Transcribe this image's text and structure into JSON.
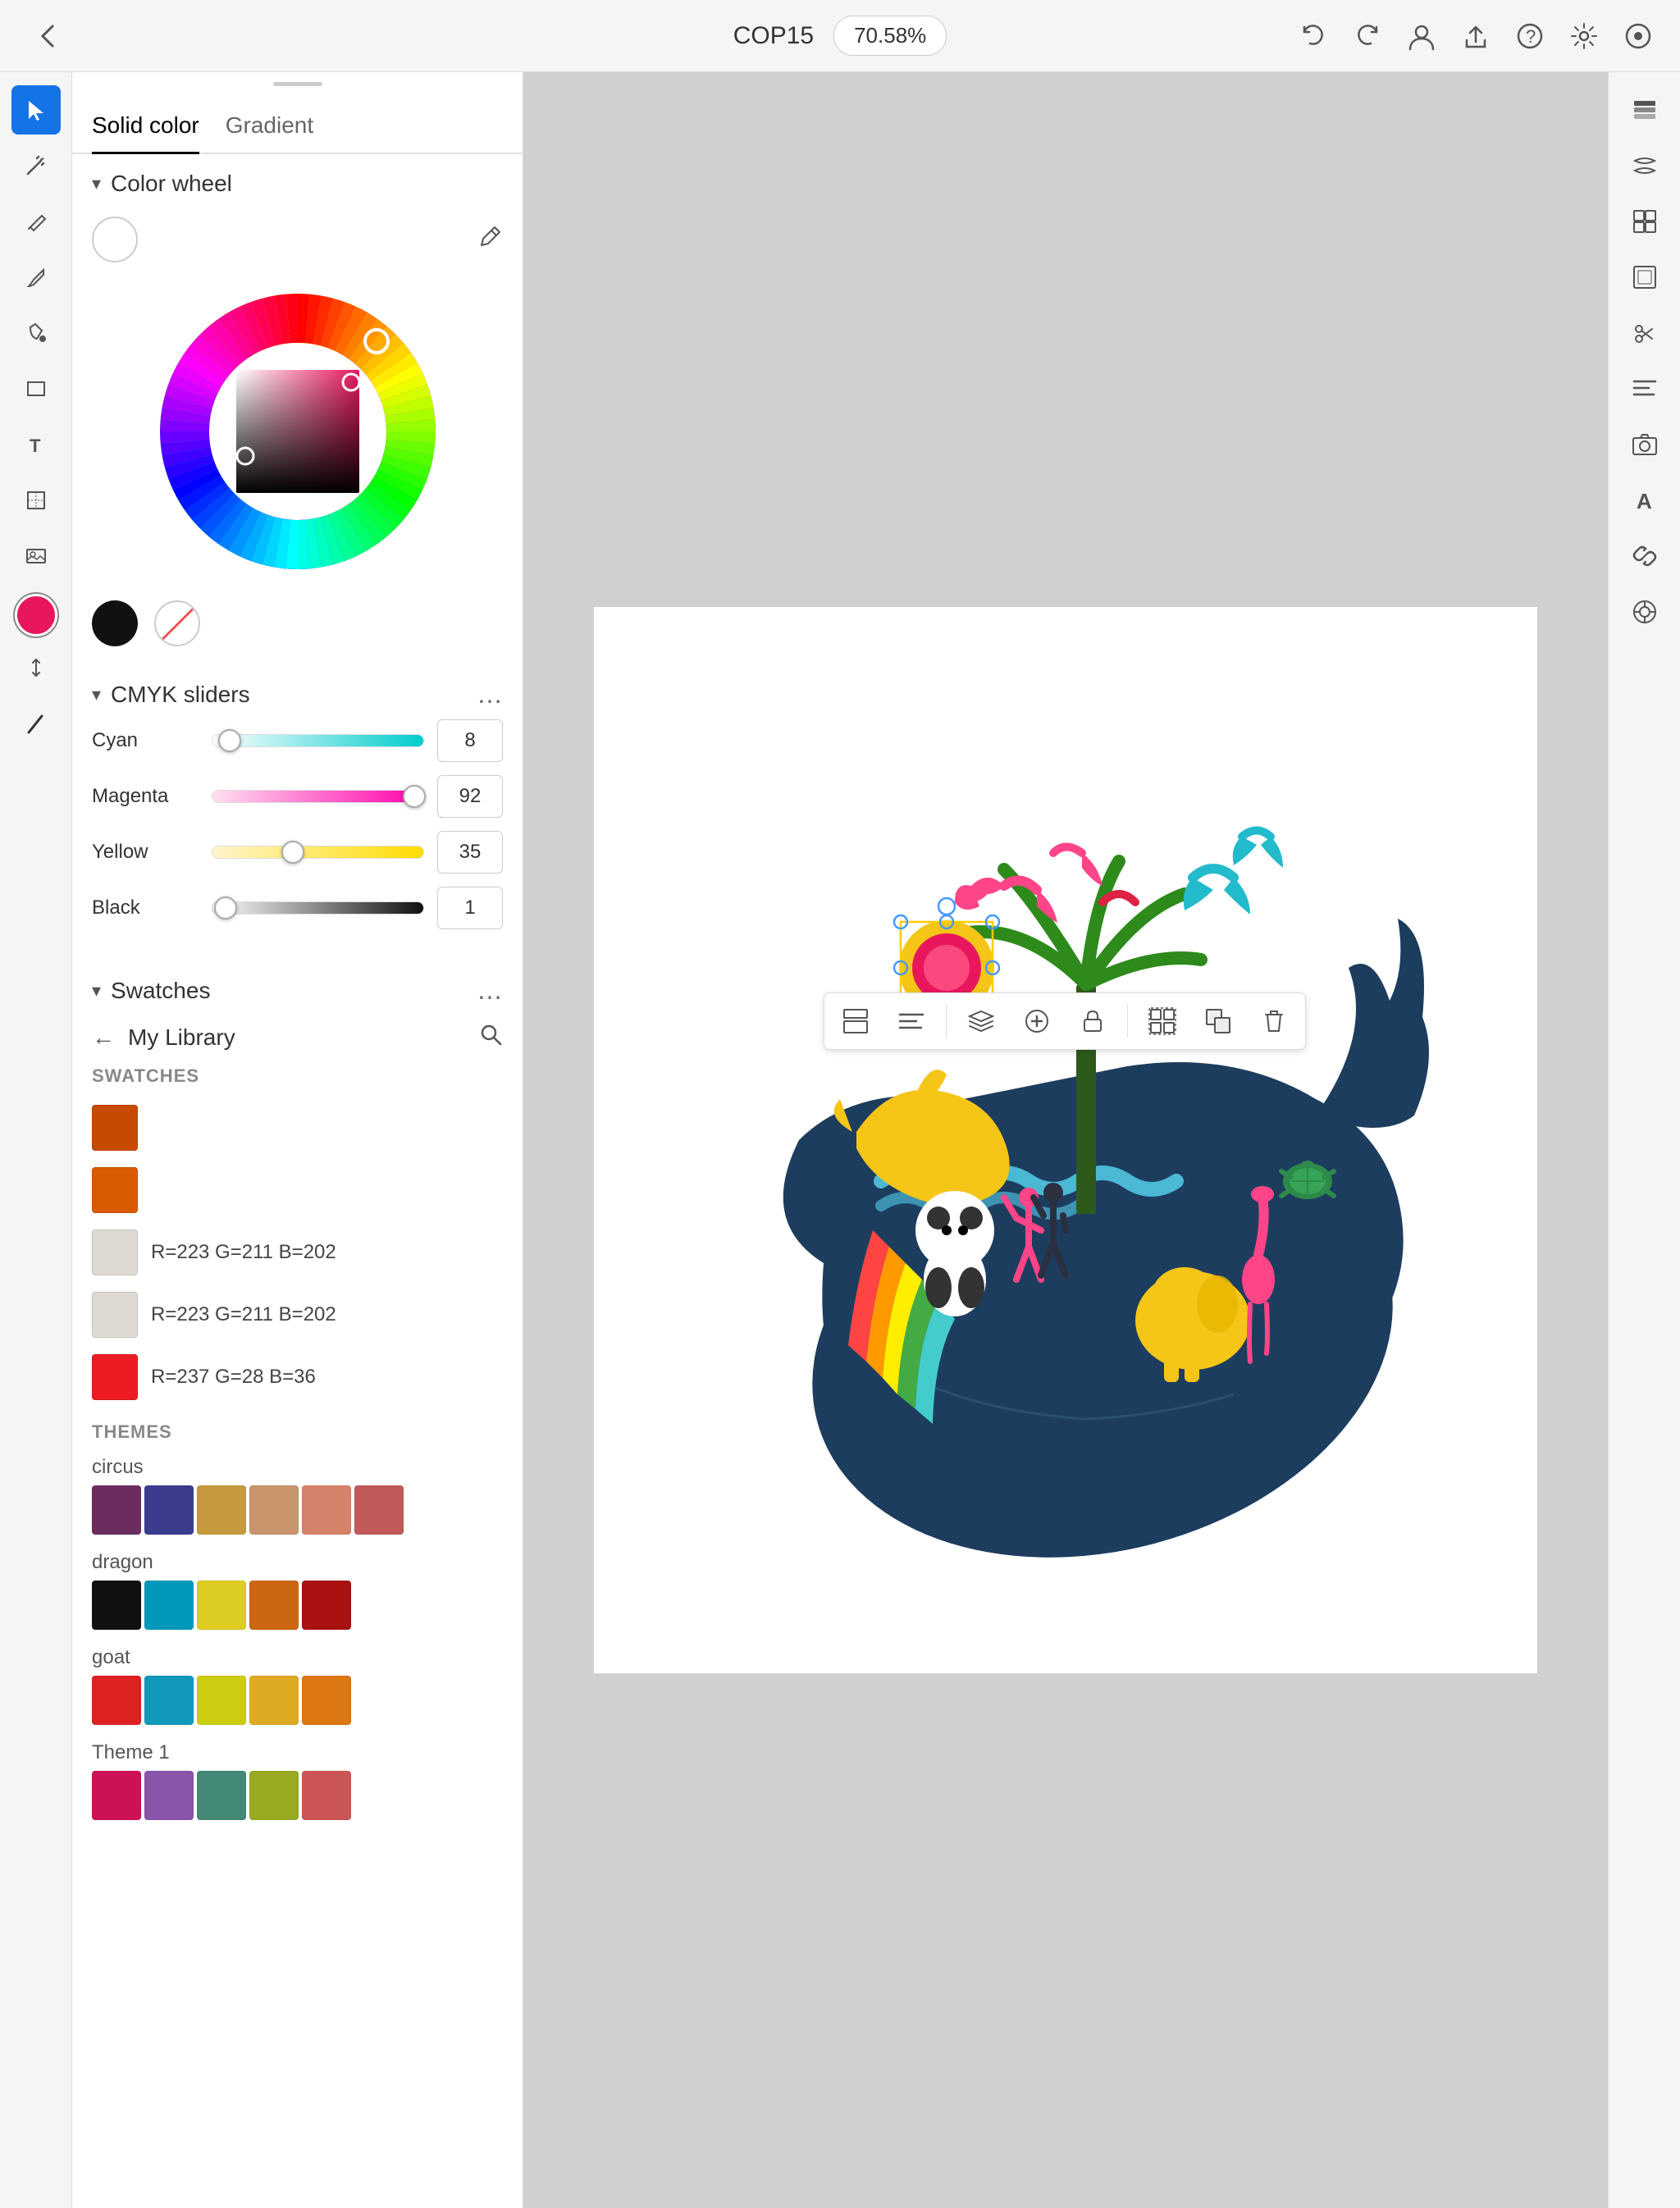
{
  "topbar": {
    "back_label": "‹",
    "title": "COP15",
    "zoom": "70.58%",
    "undo_icon": "↩",
    "redo_icon": "↪",
    "user_icon": "👤",
    "share_icon": "⬆",
    "help_icon": "?",
    "settings_icon": "⚙",
    "layers_icon": "⊞"
  },
  "left_toolbar": {
    "tools": [
      {
        "name": "select",
        "icon": "▶",
        "active": true
      },
      {
        "name": "magic-wand",
        "icon": "✦"
      },
      {
        "name": "pen",
        "icon": "✏"
      },
      {
        "name": "brush",
        "icon": "🖌"
      },
      {
        "name": "fill",
        "icon": "🪣"
      },
      {
        "name": "rectangle",
        "icon": "□"
      },
      {
        "name": "text",
        "icon": "T"
      },
      {
        "name": "transform",
        "icon": "⤢"
      },
      {
        "name": "image",
        "icon": "🖼"
      },
      {
        "name": "color-circle",
        "icon": ""
      },
      {
        "name": "arrange",
        "icon": "⇅"
      },
      {
        "name": "stroke",
        "icon": "/"
      }
    ]
  },
  "right_toolbar": {
    "tools": [
      {
        "name": "layers-panel",
        "icon": "⊞"
      },
      {
        "name": "fx-panel",
        "icon": "≋"
      },
      {
        "name": "properties-panel",
        "icon": "▦"
      },
      {
        "name": "transform-panel",
        "icon": "⊠"
      },
      {
        "name": "scissors-tool",
        "icon": "✂"
      },
      {
        "name": "align-panel",
        "icon": "≡"
      },
      {
        "name": "camera-panel",
        "icon": "⊙"
      },
      {
        "name": "type-panel",
        "icon": "A"
      },
      {
        "name": "link-panel",
        "icon": "⤻"
      },
      {
        "name": "symbols-panel",
        "icon": "⊛"
      }
    ]
  },
  "color_panel": {
    "tabs": [
      {
        "label": "Solid color",
        "active": true
      },
      {
        "label": "Gradient",
        "active": false
      }
    ],
    "color_wheel": {
      "section_title": "Color wheel",
      "collapsed": false
    },
    "cmyk": {
      "section_title": "CMYK sliders",
      "collapsed": false,
      "more_icon": "…",
      "channels": [
        {
          "label": "Cyan",
          "value": 8,
          "percent": 0.03
        },
        {
          "label": "Magenta",
          "value": 92,
          "percent": 0.92
        },
        {
          "label": "Yellow",
          "value": 35,
          "percent": 0.35
        },
        {
          "label": "Black",
          "value": 1,
          "percent": 0.01
        }
      ]
    },
    "swatches": {
      "section_title": "Swatches",
      "more_icon": "…",
      "nav_back": "←",
      "nav_title": "My Library",
      "search_icon": "🔍",
      "group_label": "SWATCHES",
      "items": [
        {
          "color": "#c84a00",
          "label": ""
        },
        {
          "color": "#d95a00",
          "label": ""
        },
        {
          "color": "#dfd9d4",
          "label": "R=223 G=211 B=202"
        },
        {
          "color": "#dfd9d4",
          "label": "R=223 G=211 B=202"
        },
        {
          "color": "#ed1c24",
          "label": "R=237 G=28 B=36"
        }
      ]
    },
    "themes": {
      "label": "THEMES",
      "items": [
        {
          "name": "circus",
          "colors": [
            "#6b2d5e",
            "#3c3c8f",
            "#c49a3c",
            "#c8956c",
            "#d4826a",
            "#c05a5a"
          ]
        },
        {
          "name": "dragon",
          "colors": [
            "#111111",
            "#0099bb",
            "#ddcc22",
            "#cc6611",
            "#aa1111"
          ]
        },
        {
          "name": "goat",
          "colors": [
            "#dd2222",
            "#1199bb",
            "#cccc11",
            "#ddaa22",
            "#dd7711"
          ]
        },
        {
          "name": "Theme 1",
          "colors": [
            "#cc1155",
            "#8855aa",
            "#448877",
            "#99aa22",
            "#cc5555"
          ]
        }
      ]
    }
  },
  "canvas": {
    "background": "#d4d4d4",
    "surface_bg": "#ffffff"
  },
  "floating_toolbar": {
    "buttons": [
      "☰",
      "≡",
      "⊕",
      "⊕",
      "🔒",
      "⊞",
      "⊡",
      "🗑"
    ]
  }
}
